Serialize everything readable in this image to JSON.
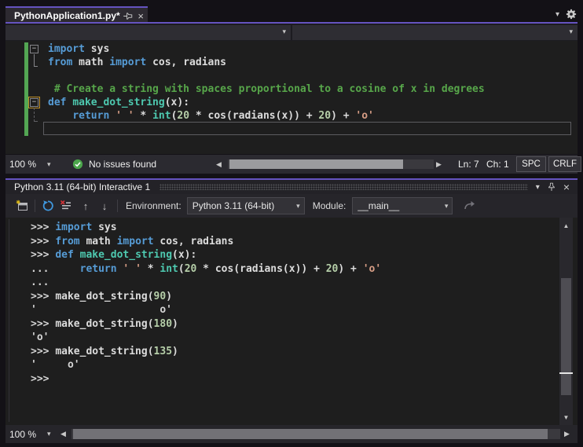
{
  "colors": {
    "accent": "#6553c0",
    "keyword": "#569cd6",
    "function": "#4ec9b0",
    "string": "#d69d85",
    "number": "#b5cea8",
    "comment": "#57a64a",
    "change_bar": "#53a653",
    "check_green": "#4ca64c"
  },
  "icons": {
    "chevron_down": "▾",
    "scroll_left": "◀",
    "scroll_right": "▶",
    "scroll_up": "▲",
    "scroll_down": "▼",
    "history_prev": "↑",
    "history_next": "↓",
    "close": "×",
    "fold_collapse": "−"
  },
  "tab_bar": {
    "active_tab": "PythonApplication1.py*"
  },
  "editor": {
    "lines": [
      [
        [
          "kw",
          "import"
        ],
        [
          "pl",
          " sys"
        ]
      ],
      [
        [
          "kw",
          "from"
        ],
        [
          "pl",
          " math "
        ],
        [
          "kw",
          "import"
        ],
        [
          "pl",
          " cos, radians"
        ]
      ],
      [],
      [
        [
          "com",
          " # Create a string with spaces proportional to a cosine of x in degrees"
        ]
      ],
      [
        [
          "kw",
          "def"
        ],
        [
          "pl",
          " "
        ],
        [
          "fn",
          "make_dot_string"
        ],
        [
          "pl",
          "(x):"
        ]
      ],
      [
        [
          "pl",
          "    "
        ],
        [
          "kw",
          "return"
        ],
        [
          "pl",
          " "
        ],
        [
          "str",
          "' '"
        ],
        [
          "pl",
          " * "
        ],
        [
          "fn",
          "int"
        ],
        [
          "pl",
          "("
        ],
        [
          "num",
          "20"
        ],
        [
          "pl",
          " * cos(radians(x)) + "
        ],
        [
          "num",
          "20"
        ],
        [
          "pl",
          ") + "
        ],
        [
          "str",
          "'o'"
        ]
      ],
      []
    ]
  },
  "editor_status": {
    "zoom": "100 %",
    "status": "No issues found",
    "line": "Ln: 7",
    "column": "Ch: 1",
    "spaces": "SPC",
    "line_ending": "CRLF"
  },
  "interactive": {
    "title": "Python 3.11 (64-bit) Interactive 1",
    "environment_label": "Environment:",
    "environment_value": "Python 3.11 (64-bit)",
    "module_label": "Module:",
    "module_value": "__main__",
    "zoom": "100 %",
    "lines": [
      [
        [
          "pr",
          ">>> "
        ],
        [
          "kw",
          "import"
        ],
        [
          "pl",
          " sys"
        ]
      ],
      [
        [
          "pr",
          ">>> "
        ],
        [
          "kw",
          "from"
        ],
        [
          "pl",
          " math "
        ],
        [
          "kw",
          "import"
        ],
        [
          "pl",
          " cos, radians"
        ]
      ],
      [
        [
          "pr",
          ">>> "
        ],
        [
          "kw",
          "def"
        ],
        [
          "pl",
          " "
        ],
        [
          "fn",
          "make_dot_string"
        ],
        [
          "pl",
          "(x):"
        ]
      ],
      [
        [
          "pr",
          "... "
        ],
        [
          "pl",
          "    "
        ],
        [
          "kw",
          "return"
        ],
        [
          "pl",
          " "
        ],
        [
          "str",
          "' '"
        ],
        [
          "pl",
          " * "
        ],
        [
          "fn",
          "int"
        ],
        [
          "pl",
          "("
        ],
        [
          "num",
          "20"
        ],
        [
          "pl",
          " * cos(radians(x)) + "
        ],
        [
          "num",
          "20"
        ],
        [
          "pl",
          ") + "
        ],
        [
          "str",
          "'o'"
        ]
      ],
      [
        [
          "pr",
          "... "
        ]
      ],
      [
        [
          "pr",
          ">>> "
        ],
        [
          "pl",
          "make_dot_string("
        ],
        [
          "num",
          "90"
        ],
        [
          "pl",
          ")"
        ]
      ],
      [
        [
          "out",
          "'                    o'"
        ]
      ],
      [
        [
          "pr",
          ">>> "
        ],
        [
          "pl",
          "make_dot_string("
        ],
        [
          "num",
          "180"
        ],
        [
          "pl",
          ")"
        ]
      ],
      [
        [
          "out",
          "'o'"
        ]
      ],
      [
        [
          "pr",
          ">>> "
        ],
        [
          "pl",
          "make_dot_string("
        ],
        [
          "num",
          "135"
        ],
        [
          "pl",
          ")"
        ]
      ],
      [
        [
          "out",
          "'     o'"
        ]
      ],
      [
        [
          "pr",
          ">>> "
        ]
      ]
    ]
  }
}
